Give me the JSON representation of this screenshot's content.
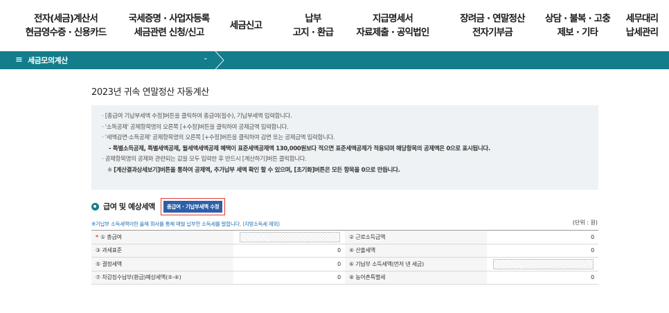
{
  "nav": [
    {
      "line1": "전자(세금)계산서",
      "line2": "현금영수증 · 신용카드"
    },
    {
      "line1": "국세증명 · 사업자등록",
      "line2": "세금관련 신청/신고"
    },
    {
      "line1": "세금신고",
      "line2": ""
    },
    {
      "line1": "납부",
      "line2": "고지 · 환급"
    },
    {
      "line1": "지급명세서",
      "line2": "자료제출 · 공익법인"
    },
    {
      "line1": "장려금 · 연말정산",
      "line2": "전자기부금"
    },
    {
      "line1": "상담 · 불복 · 고충",
      "line2": "제보 · 기타"
    },
    {
      "line1": "세무대리",
      "line2": "납세관리"
    }
  ],
  "subbar": {
    "menu_label": "세금모의계산",
    "hamburger_glyph": "≡",
    "chevron_glyph": "⌄",
    "accent": "#137d8c"
  },
  "page_title": "2023년 귀속 연말정산 자동계산",
  "info": {
    "lines": [
      "· [총급여 기납부세액 수정]버튼을 클릭하여 총급여(필수), 기납부세액 입력합니다.",
      "· '소득공제' 공제항목명의 오른쪽 [+수정]버튼을 클릭하여 공제금액 입력합니다.",
      "· '세액감면·소득공제' 공제항목명의 오른쪽 [+수정]버튼을 클릭하여 감면 또는 공제금액 입력합니다."
    ],
    "bold_line": "- 특별소득공제, 특별세액공제, 월세액세액공제 혜택이 표준세액공제액 130,000원보다 적으면 표준세액공제가 적용되며 해당항목의 공제액은 0으로 표시됩니다.",
    "line5": "· 공제항목명의 공제와 관련되는 값을 모두 입력한 후 반드시 [계산하기]버튼 클릭합니다.",
    "line6_prefix": "※ ",
    "line6_bold": "[계산결과상세보기]버튼을 통하여 공제액, 추가납부 세액 확인 할 수 있으며, [초기화]버튼은 모든 항목을 0으로 만듭니다."
  },
  "section": {
    "title": "급여 및 예상세액",
    "edit_button": "총급여 · 기납부세액 수정",
    "highlight": "#e33b2e",
    "button_color": "#2e5fa8"
  },
  "note": "※기납부 소득세액이란 올해 회사를 통해 매월 납부한 소득세를 말합니다. (지방소득세 제외)",
  "unit": "(단위 : 원)",
  "table": {
    "rows": [
      {
        "l1": "① 총급여",
        "v1": "",
        "l2": "② 근로소득금액",
        "v2": "0"
      },
      {
        "l1": "③ 과세표준",
        "v1": "0",
        "l2": "④ 산출세액",
        "v2": "0"
      },
      {
        "l1": "⑤ 결정세액",
        "v1": "0",
        "l2": "⑥ 기납부 소득세액(먼저 낸 세금)",
        "v2": ""
      },
      {
        "l1": "⑦ 차감징수납부(환급)예상세액(⑤-⑥)",
        "v1": "0",
        "l2": "⑧ 농어촌특별세",
        "v2": "0"
      }
    ],
    "required_mark": "*"
  }
}
